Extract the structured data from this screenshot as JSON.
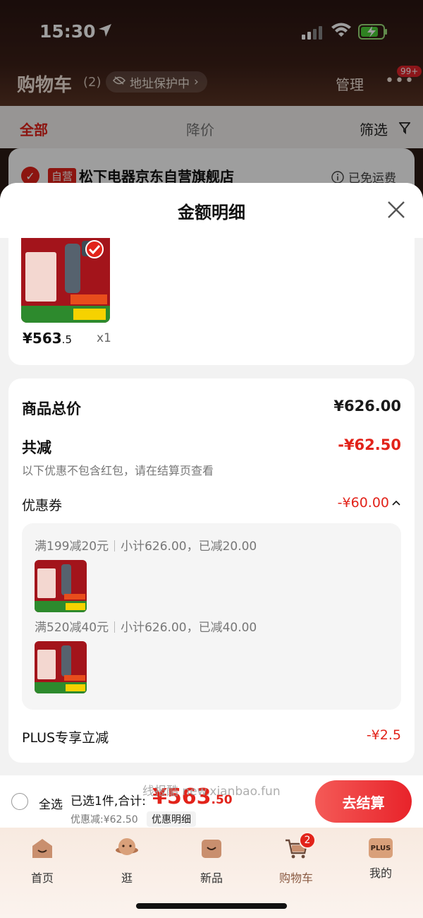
{
  "status_bar": {
    "time": "15:30"
  },
  "cart_header": {
    "title": "购物车",
    "count": "(2)",
    "address_protection": "地址保护中",
    "manage": "管理",
    "more_badge": "99+"
  },
  "tabs": {
    "all": "全部",
    "price_drop": "降价",
    "filter": "筛选"
  },
  "store": {
    "tag": "自营",
    "name": "松下电器京东自营旗舰店",
    "shipping": "已免运费"
  },
  "sheet": {
    "title": "金额明细",
    "product": {
      "price_main": "¥563",
      "price_decimal": ".5",
      "quantity": "x1"
    },
    "total_label": "商品总价",
    "total_value": "¥626.00",
    "reduction_label": "共减",
    "reduction_value": "-¥62.50",
    "note": "以下优惠不包含红包，请在结算页查看",
    "coupon_label": "优惠券",
    "coupon_value": "-¥60.00",
    "coupons": [
      {
        "rule": "满199减20元",
        "summary": "小计626.00，已减20.00"
      },
      {
        "rule": "满520减40元",
        "summary": "小计626.00，已减40.00"
      }
    ],
    "plus_label": "PLUS专享立减",
    "plus_value": "-¥2.5"
  },
  "checkout": {
    "select_all": "全选",
    "selected_text": "已选1件,合计:",
    "total_main": "¥563",
    "total_decimal": ".50",
    "discount": "优惠减:¥62.50",
    "detail_link": "优惠明细",
    "button": "去结算",
    "watermark": "线报酷 new.xianbao.fun"
  },
  "tabbar": {
    "items": [
      {
        "label": "首页"
      },
      {
        "label": "逛"
      },
      {
        "label": "新品"
      },
      {
        "label": "购物车",
        "badge": "2"
      },
      {
        "label": "我的",
        "icon_text": "PLUS"
      }
    ]
  },
  "colors": {
    "accent": "#e2231a",
    "sheet_bg": "#f2f2f2"
  },
  "icons": [
    "location-arrow-icon",
    "signal-icon",
    "wifi-icon",
    "battery-charging-icon",
    "shield-icon",
    "chevron-right-icon",
    "filter-icon",
    "close-icon",
    "chevron-up-icon",
    "home-icon",
    "explore-icon",
    "new-icon",
    "cart-icon",
    "plus-member-icon"
  ]
}
